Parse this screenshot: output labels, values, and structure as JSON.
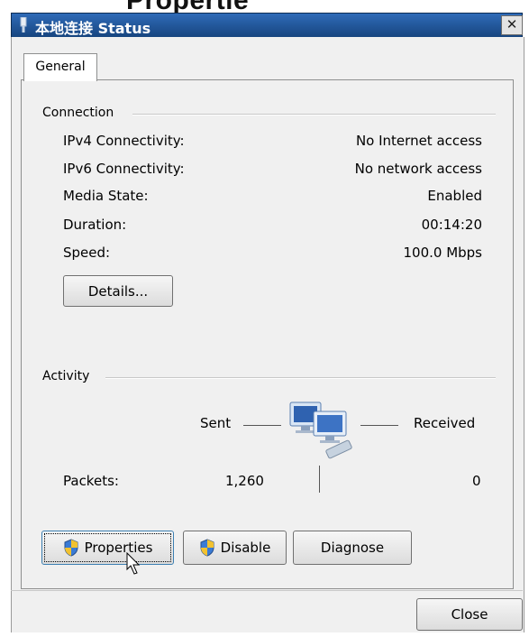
{
  "cropped_heading": "Propertie",
  "window": {
    "title": "本地连接 Status",
    "close_glyph": "✕"
  },
  "tabs": [
    {
      "label": "General"
    }
  ],
  "connection": {
    "group_label": "Connection",
    "rows": [
      {
        "label": "IPv4 Connectivity:",
        "value": "No Internet access"
      },
      {
        "label": "IPv6 Connectivity:",
        "value": "No network access"
      },
      {
        "label": "Media State:",
        "value": "Enabled"
      },
      {
        "label": "Duration:",
        "value": "00:14:20"
      },
      {
        "label": "Speed:",
        "value": "100.0 Mbps"
      }
    ],
    "details_button": "Details..."
  },
  "activity": {
    "group_label": "Activity",
    "sent_label": "Sent",
    "received_label": "Received",
    "packets_label": "Packets:",
    "packets_sent": "1,260",
    "packets_received": "0",
    "network_icon": "network-computers-icon"
  },
  "buttons": {
    "properties": "Properties",
    "disable": "Disable",
    "diagnose": "Diagnose",
    "close": "Close"
  },
  "colors": {
    "titlebar": "#2f6bb8",
    "dialog_bg": "#f0f0f0",
    "shield_blue": "#3a7bd5",
    "shield_yellow": "#f2c230"
  }
}
